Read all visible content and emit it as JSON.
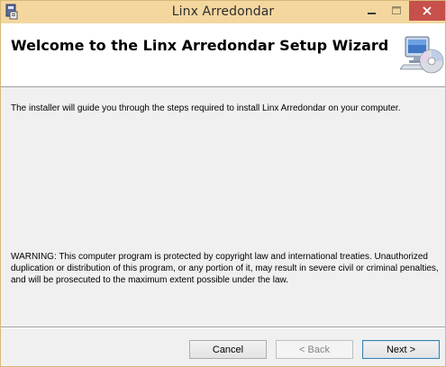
{
  "window": {
    "title": "Linx Arredondar",
    "controls": {
      "minimize": "—",
      "maximize": "□",
      "close": "✕"
    }
  },
  "banner": {
    "heading": "Welcome to the Linx Arredondar Setup Wizard",
    "icon": "computer-cd-icon"
  },
  "body": {
    "intro": "The installer will guide you through the steps required to install Linx Arredondar on your computer.",
    "warning": "WARNING: This computer program is protected by copyright law and international treaties. Unauthorized duplication or distribution of this program, or any portion of it, may result in severe civil or criminal penalties, and will be prosecuted to the maximum extent possible under the law."
  },
  "buttons": {
    "cancel": "Cancel",
    "back": "< Back",
    "next": "Next >"
  },
  "colors": {
    "titlebar": "#f4d79f",
    "close_button": "#c7504b",
    "accent_border": "#3c7fb1"
  }
}
